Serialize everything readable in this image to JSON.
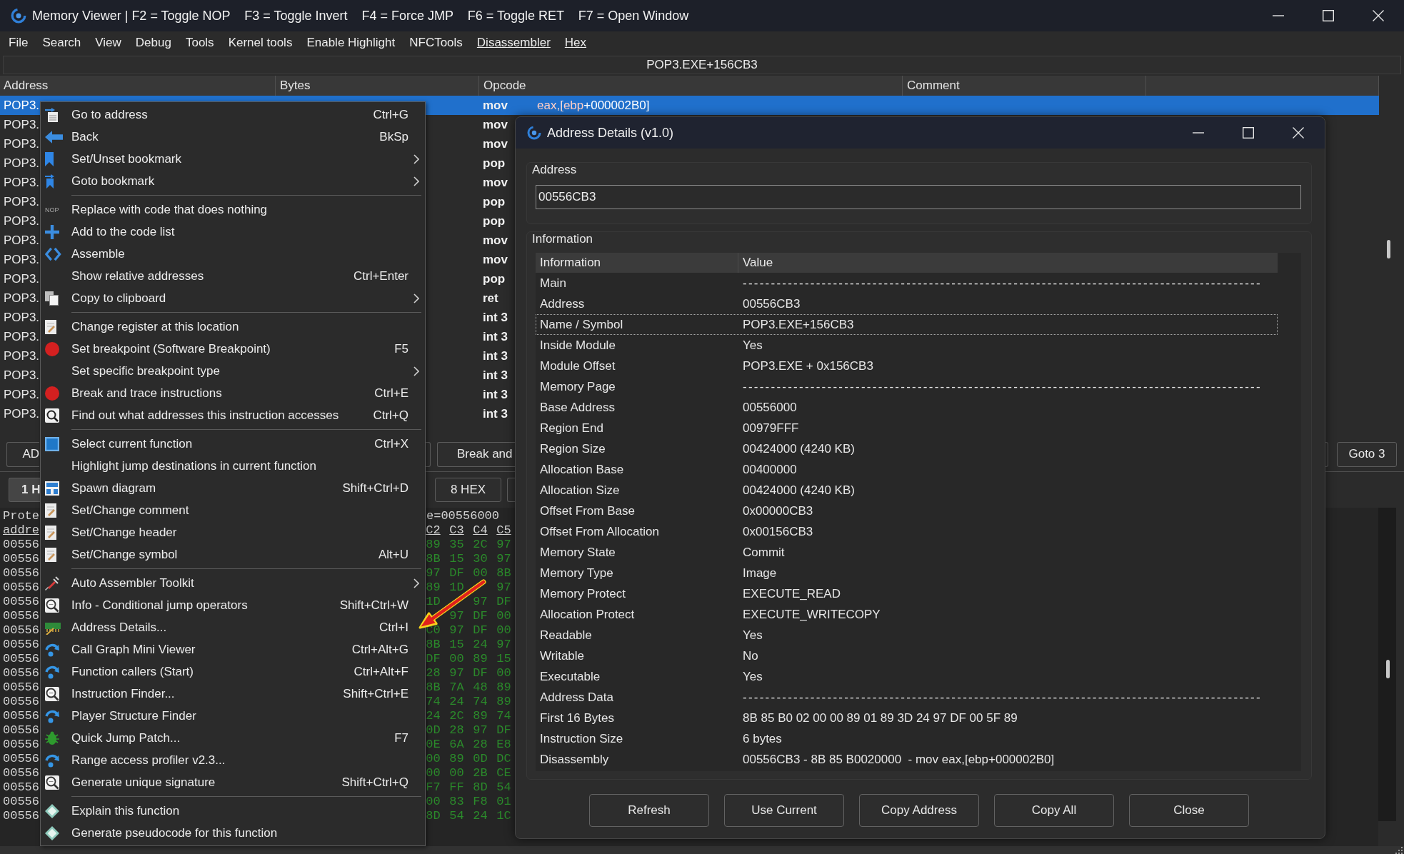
{
  "window": {
    "title": "Memory Viewer | F2 = Toggle NOP    F3 = Toggle Invert    F4 = Force JMP    F6 = Toggle RET    F7 = Open Window"
  },
  "menu_bar": [
    {
      "label": "File",
      "underlined": false
    },
    {
      "label": "Search",
      "underlined": false
    },
    {
      "label": "View",
      "underlined": false
    },
    {
      "label": "Debug",
      "underlined": false
    },
    {
      "label": "Tools",
      "underlined": false
    },
    {
      "label": "Kernel tools",
      "underlined": false
    },
    {
      "label": "Enable Highlight",
      "underlined": false
    },
    {
      "label": "NFCTools",
      "underlined": false
    },
    {
      "label": "Disassembler",
      "underlined": true
    },
    {
      "label": "Hex",
      "underlined": true
    }
  ],
  "address_bar": {
    "value": "POP3.EXE+156CB3"
  },
  "disassembly": {
    "columns": [
      "Address",
      "Bytes",
      "Opcode",
      "Comment"
    ],
    "rows": [
      {
        "address": "POP3.",
        "opcode": "mov",
        "selected": true,
        "operand": [
          {
            "text": "eax",
            "kind": "register"
          },
          {
            "text": ",[",
            "kind": "punctuation"
          },
          {
            "text": "ebp",
            "kind": "register"
          },
          {
            "text": "+000002B0]",
            "kind": "value"
          }
        ]
      },
      {
        "address": "POP3.",
        "opcode": "mov",
        "selected": false
      },
      {
        "address": "POP3.",
        "opcode": "mov",
        "selected": false
      },
      {
        "address": "POP3.",
        "opcode": "pop",
        "selected": false
      },
      {
        "address": "POP3.",
        "opcode": "mov",
        "selected": false
      },
      {
        "address": "POP3.",
        "opcode": "pop",
        "selected": false
      },
      {
        "address": "POP3.",
        "opcode": "pop",
        "selected": false
      },
      {
        "address": "POP3.",
        "opcode": "mov",
        "selected": false
      },
      {
        "address": "POP3.",
        "opcode": "mov",
        "selected": false
      },
      {
        "address": "POP3.",
        "opcode": "pop",
        "selected": false
      },
      {
        "address": "POP3.",
        "opcode": "ret",
        "selected": false
      },
      {
        "address": "POP3.",
        "opcode": "int 3",
        "selected": false
      },
      {
        "address": "POP3.",
        "opcode": "int 3",
        "selected": false
      },
      {
        "address": "POP3.",
        "opcode": "int 3",
        "selected": false
      },
      {
        "address": "POP3.",
        "opcode": "int 3",
        "selected": false
      },
      {
        "address": "POP3.",
        "opcode": "int 3",
        "selected": false
      },
      {
        "address": "POP3.",
        "opcode": "int 3",
        "selected": false
      }
    ]
  },
  "toolbar_1": {
    "buttons": [
      "AD",
      "Break and",
      "Goto 3"
    ]
  },
  "toolbar_2": {
    "buttons": [
      {
        "label": "1 H",
        "selected": true
      },
      {
        "label": "8 HEX",
        "selected": false
      }
    ]
  },
  "hex_view": {
    "info": [
      "Prote",
      "e=00556000"
    ],
    "header": {
      "address": "addre",
      "columns": [
        "C2",
        "C3",
        "C4",
        "C5"
      ]
    },
    "rows": [
      {
        "address": "00556",
        "bytes": {
          "col_1": "89",
          "col_2": "35",
          "col_3": "2C",
          "col_4": "97"
        }
      },
      {
        "address": "00556",
        "bytes": {
          "col_1": "8B",
          "col_2": "15",
          "col_3": "30",
          "col_4": "97"
        }
      },
      {
        "address": "00556",
        "bytes": {
          "col_1": "97",
          "col_2": "DF",
          "col_3": "00",
          "col_4": "8B"
        }
      },
      {
        "address": "00556",
        "bytes": {
          "col_1": "89",
          "col_2": "1D",
          "col_4": "97"
        }
      },
      {
        "address": "00556",
        "bytes": {
          "col_1": "1D",
          "col_3": "97",
          "col_4": "DF"
        }
      },
      {
        "address": "00556",
        "bytes": {
          "col_2": "97",
          "col_3": "DF",
          "col_4": "00"
        }
      },
      {
        "address": "00556",
        "bytes": {
          "col_1": "C0",
          "col_2": "97",
          "col_3": "DF",
          "col_4": "00"
        }
      },
      {
        "address": "00556",
        "bytes": {
          "col_1": "8B",
          "col_2": "15",
          "col_3": "24",
          "col_4": "97"
        }
      },
      {
        "address": "00556",
        "bytes": {
          "col_1": "DF",
          "col_2": "00",
          "col_3": "89",
          "col_4": "15"
        }
      },
      {
        "address": "00556",
        "bytes": {
          "col_1": "28",
          "col_2": "97",
          "col_3": "DF",
          "col_4": "00"
        }
      },
      {
        "address": "00556",
        "bytes": {
          "col_1": "8B",
          "col_2": "7A",
          "col_3": "48",
          "col_4": "89"
        }
      },
      {
        "address": "00556",
        "bytes": {
          "col_1": "74",
          "col_2": "24",
          "col_3": "74",
          "col_4": "89"
        }
      },
      {
        "address": "00556",
        "bytes": {
          "col_1": "24",
          "col_2": "2C",
          "col_3": "89",
          "col_4": "74"
        }
      },
      {
        "address": "00556",
        "bytes": {
          "col_1": "0D",
          "col_2": "28",
          "col_3": "97",
          "col_4": "DF"
        }
      },
      {
        "address": "00556",
        "bytes": {
          "col_1": "0E",
          "col_2": "6A",
          "col_3": "28",
          "col_4": "E8"
        }
      },
      {
        "address": "00556",
        "bytes": {
          "col_1": "00",
          "col_2": "89",
          "col_3": "0D",
          "col_4": "DC"
        }
      },
      {
        "address": "00556",
        "bytes": {
          "col_1": "00",
          "col_2": "00",
          "col_3": "2B",
          "col_4": "CE"
        }
      },
      {
        "address": "00556",
        "bytes": {
          "col_1": "F7",
          "col_2": "FF",
          "col_3": "8D",
          "col_4": "54"
        }
      },
      {
        "address": "00556",
        "bytes": {
          "col_1": "00",
          "col_2": "83",
          "col_3": "F8",
          "col_4": "01"
        }
      },
      {
        "address": "00556",
        "bytes": {
          "col_1": "8D",
          "col_2": "54",
          "col_3": "24",
          "col_4": "1C"
        }
      }
    ]
  },
  "context_menu": {
    "groups": [
      [
        {
          "label": "Go to address",
          "shortcut": "Ctrl+G",
          "submenu": false,
          "kind": "goto"
        },
        {
          "label": "Back",
          "shortcut": "BkSp",
          "submenu": false,
          "kind": "back"
        },
        {
          "label": "Set/Unset bookmark",
          "submenu": true,
          "kind": "bookmark"
        },
        {
          "label": "Goto bookmark",
          "submenu": true,
          "kind": "jumpmark"
        }
      ],
      [
        {
          "label": "Replace with code that does nothing",
          "submenu": false,
          "kind": "badge",
          "badge": "NOP"
        },
        {
          "label": "Add to the code list",
          "submenu": false,
          "kind": "add"
        },
        {
          "label": "Assemble",
          "submenu": false,
          "kind": "assemble"
        },
        {
          "label": "Show relative addresses",
          "shortcut": "Ctrl+Enter",
          "submenu": false,
          "kind": "plain"
        },
        {
          "label": "Copy to clipboard",
          "submenu": true,
          "kind": "copy"
        }
      ],
      [
        {
          "label": "Change register at this location",
          "submenu": false,
          "kind": "note"
        },
        {
          "label": "Set breakpoint (Software Breakpoint)",
          "shortcut": "F5",
          "submenu": false,
          "kind": "breakpoint"
        },
        {
          "label": "Set specific breakpoint type",
          "submenu": true,
          "kind": "plain"
        },
        {
          "label": "Break and trace instructions",
          "shortcut": "Ctrl+E",
          "submenu": false,
          "kind": "breakpoint"
        },
        {
          "label": "Find out what addresses this instruction accesses",
          "shortcut": "Ctrl+Q",
          "submenu": false,
          "kind": "search"
        }
      ],
      [
        {
          "label": "Select current function",
          "shortcut": "Ctrl+X",
          "submenu": false,
          "kind": "function"
        },
        {
          "label": "Highlight jump destinations in current function",
          "submenu": false,
          "kind": "plain"
        },
        {
          "label": "Spawn diagram",
          "shortcut": "Shift+Ctrl+D",
          "submenu": false,
          "kind": "diagram"
        },
        {
          "label": "Set/Change comment",
          "submenu": false,
          "kind": "note"
        },
        {
          "label": "Set/Change header",
          "submenu": false,
          "kind": "note"
        },
        {
          "label": "Set/Change symbol",
          "shortcut": "Alt+U",
          "submenu": false,
          "kind": "note"
        }
      ],
      [
        {
          "label": "Auto Assembler Toolkit",
          "submenu": true,
          "kind": "toolkit"
        },
        {
          "label": "Info - Conditional jump operators",
          "shortcut": "Shift+Ctrl+W",
          "submenu": false,
          "kind": "inspect"
        },
        {
          "label": "Address Details...",
          "shortcut": "Ctrl+I",
          "submenu": false,
          "kind": "details"
        },
        {
          "label": "Call Graph Mini Viewer",
          "shortcut": "Ctrl+Alt+G",
          "submenu": false,
          "kind": "finder"
        },
        {
          "label": "Function callers (Start)",
          "shortcut": "Ctrl+Alt+F",
          "submenu": false,
          "kind": "finder"
        },
        {
          "label": "Instruction Finder...",
          "shortcut": "Shift+Ctrl+E",
          "submenu": false,
          "kind": "inspect"
        },
        {
          "label": "Player Structure Finder",
          "submenu": false,
          "kind": "finder"
        },
        {
          "label": "Quick Jump Patch...",
          "shortcut": "F7",
          "submenu": false,
          "kind": "patch"
        },
        {
          "label": "Range access profiler v2.3...",
          "submenu": false,
          "kind": "finder"
        },
        {
          "label": "Generate unique signature",
          "shortcut": "Shift+Ctrl+Q",
          "submenu": false,
          "kind": "inspect"
        }
      ],
      [
        {
          "label": "Explain this function",
          "submenu": false,
          "kind": "ai"
        },
        {
          "label": "Generate pseudocode for this function",
          "submenu": false,
          "kind": "ai"
        }
      ]
    ]
  },
  "dialog": {
    "title": "Address Details (v1.0)",
    "address_group": {
      "label": "Address",
      "value": "00556CB3"
    },
    "info_group": {
      "label": "Information",
      "columns": [
        "Information",
        "Value"
      ],
      "rows": [
        {
          "name": "Main",
          "value": "--------------------------------------------------------------------------------------------",
          "kind": "section",
          "selected": false
        },
        {
          "name": "Address",
          "value": "00556CB3",
          "kind": "field",
          "selected": false
        },
        {
          "name": "Name / Symbol",
          "value": "POP3.EXE+156CB3",
          "kind": "field",
          "selected": true
        },
        {
          "name": "Inside Module",
          "value": "Yes",
          "kind": "field",
          "selected": false
        },
        {
          "name": "Module Offset",
          "value": "POP3.EXE + 0x156CB3",
          "kind": "field",
          "selected": false
        },
        {
          "name": "Memory Page",
          "value": "--------------------------------------------------------------------------------------------",
          "kind": "section",
          "selected": false
        },
        {
          "name": "Base Address",
          "value": "00556000",
          "kind": "field",
          "selected": false
        },
        {
          "name": "Region End",
          "value": "00979FFF",
          "kind": "field",
          "selected": false
        },
        {
          "name": "Region Size",
          "value": "00424000 (4240 KB)",
          "kind": "field",
          "selected": false
        },
        {
          "name": "Allocation Base",
          "value": "00400000",
          "kind": "field",
          "selected": false
        },
        {
          "name": "Allocation Size",
          "value": "00424000 (4240 KB)",
          "kind": "field",
          "selected": false
        },
        {
          "name": "Offset From Base",
          "value": "0x00000CB3",
          "kind": "field",
          "selected": false
        },
        {
          "name": "Offset From Allocation",
          "value": "0x00156CB3",
          "kind": "field",
          "selected": false
        },
        {
          "name": "Memory State",
          "value": "Commit",
          "kind": "field",
          "selected": false
        },
        {
          "name": "Memory Type",
          "value": "Image",
          "kind": "field",
          "selected": false
        },
        {
          "name": "Memory Protect",
          "value": "EXECUTE_READ",
          "kind": "field",
          "selected": false
        },
        {
          "name": "Allocation Protect",
          "value": "EXECUTE_WRITECOPY",
          "kind": "field",
          "selected": false
        },
        {
          "name": "Readable",
          "value": "Yes",
          "kind": "field",
          "selected": false
        },
        {
          "name": "Writable",
          "value": "No",
          "kind": "field",
          "selected": false
        },
        {
          "name": "Executable",
          "value": "Yes",
          "kind": "field",
          "selected": false
        },
        {
          "name": "Address Data",
          "value": "--------------------------------------------------------------------------------------------",
          "kind": "section",
          "selected": false
        },
        {
          "name": "First 16 Bytes",
          "value": "8B 85 B0 02 00 00 89 01 89 3D 24 97 DF 00 5F 89",
          "kind": "field",
          "selected": false
        },
        {
          "name": "Instruction Size",
          "value": "6 bytes",
          "kind": "field",
          "selected": false
        },
        {
          "name": "Disassembly",
          "value": "00556CB3 - 8B 85 B0020000  - mov eax,[ebp+000002B0]",
          "kind": "field",
          "selected": false
        }
      ]
    },
    "buttons": [
      "Refresh",
      "Use Current",
      "Copy Address",
      "Copy All",
      "Close"
    ]
  }
}
